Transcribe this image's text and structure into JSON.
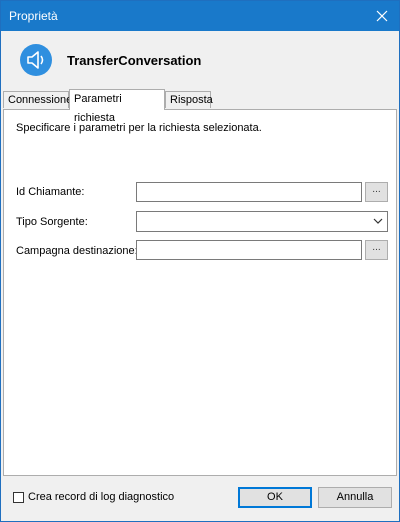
{
  "window": {
    "title": "Proprietà"
  },
  "header": {
    "name": "TransferConversation",
    "icon": "speaker-icon"
  },
  "tabs": [
    {
      "label": "Connessione",
      "active": false
    },
    {
      "label": "Parametri richiesta",
      "active": true
    },
    {
      "label": "Risposta",
      "active": false
    }
  ],
  "panel": {
    "instruction": "Specificare i parametri per la richiesta selezionata.",
    "fields": {
      "caller_id": {
        "label": "Id Chiamante:",
        "value": "",
        "browse_label": "..."
      },
      "source_type": {
        "label": "Tipo Sorgente:",
        "value": ""
      },
      "destination_campaign": {
        "label": "Campagna destinazione:",
        "value": "",
        "browse_label": "..."
      }
    }
  },
  "footer": {
    "log_checkbox_label": "Crea record di log diagnostico",
    "log_checked": false,
    "ok_label": "OK",
    "cancel_label": "Annulla"
  },
  "colors": {
    "titlebar": "#1979ca",
    "accent": "#0078d7",
    "icon": "#2f8fdf"
  }
}
